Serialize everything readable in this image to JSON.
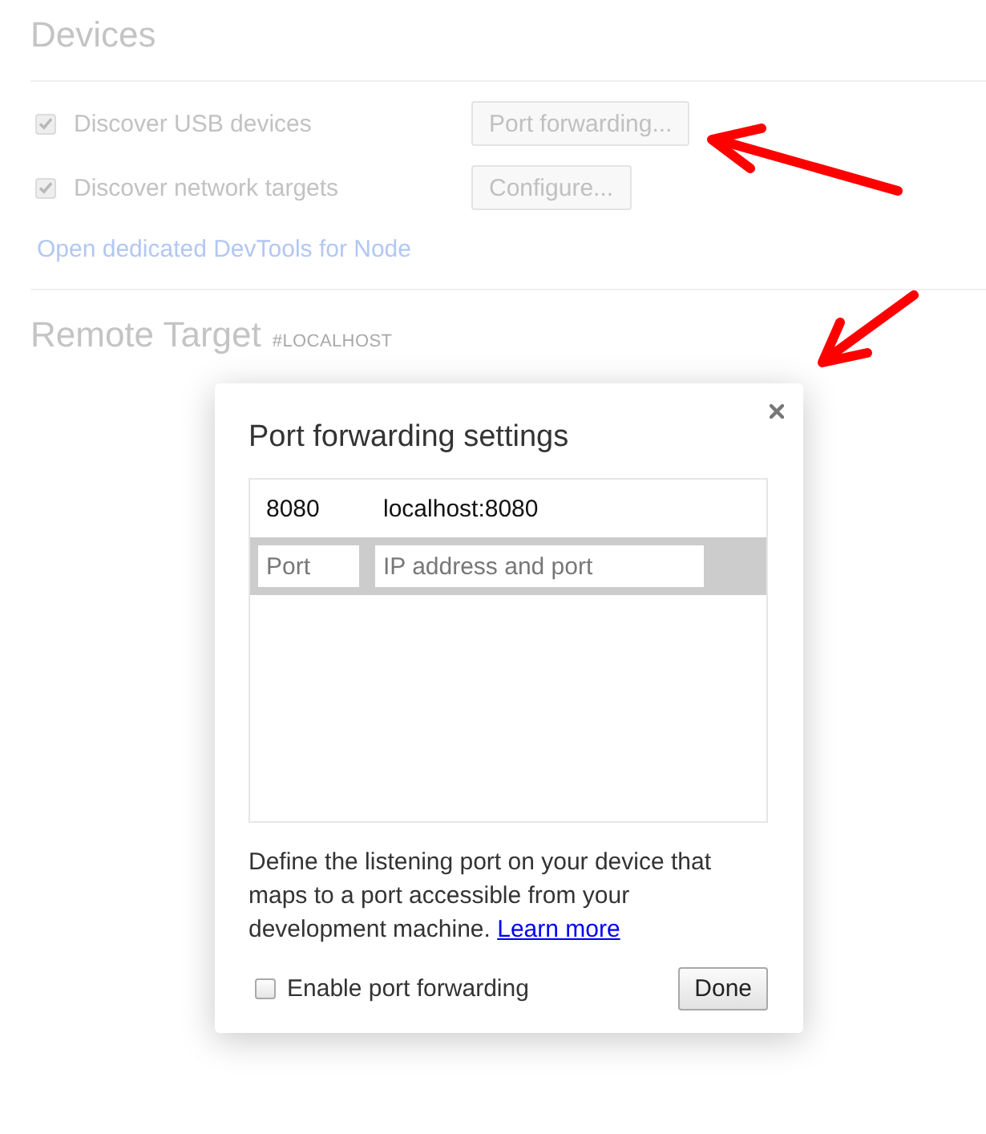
{
  "page": {
    "title": "Devices"
  },
  "device_options": [
    {
      "label": "Discover USB devices",
      "checked": true,
      "button": "Port forwarding..."
    },
    {
      "label": "Discover network targets",
      "checked": true,
      "button": "Configure..."
    }
  ],
  "node_link": "Open dedicated DevTools for Node",
  "remote_target": {
    "title": "Remote Target",
    "tag": "#LOCALHOST"
  },
  "dialog": {
    "title": "Port forwarding settings",
    "rules": [
      {
        "port": "8080",
        "address": "localhost:8080"
      }
    ],
    "new_rule": {
      "port": {
        "placeholder": "Port"
      },
      "address": {
        "placeholder": "IP address and port"
      }
    },
    "description": "Define the listening port on your device that maps to a port accessible from your development machine.",
    "learn_more": "Learn more",
    "enable": {
      "label": "Enable port forwarding",
      "checked": false
    },
    "done_button": "Done"
  }
}
